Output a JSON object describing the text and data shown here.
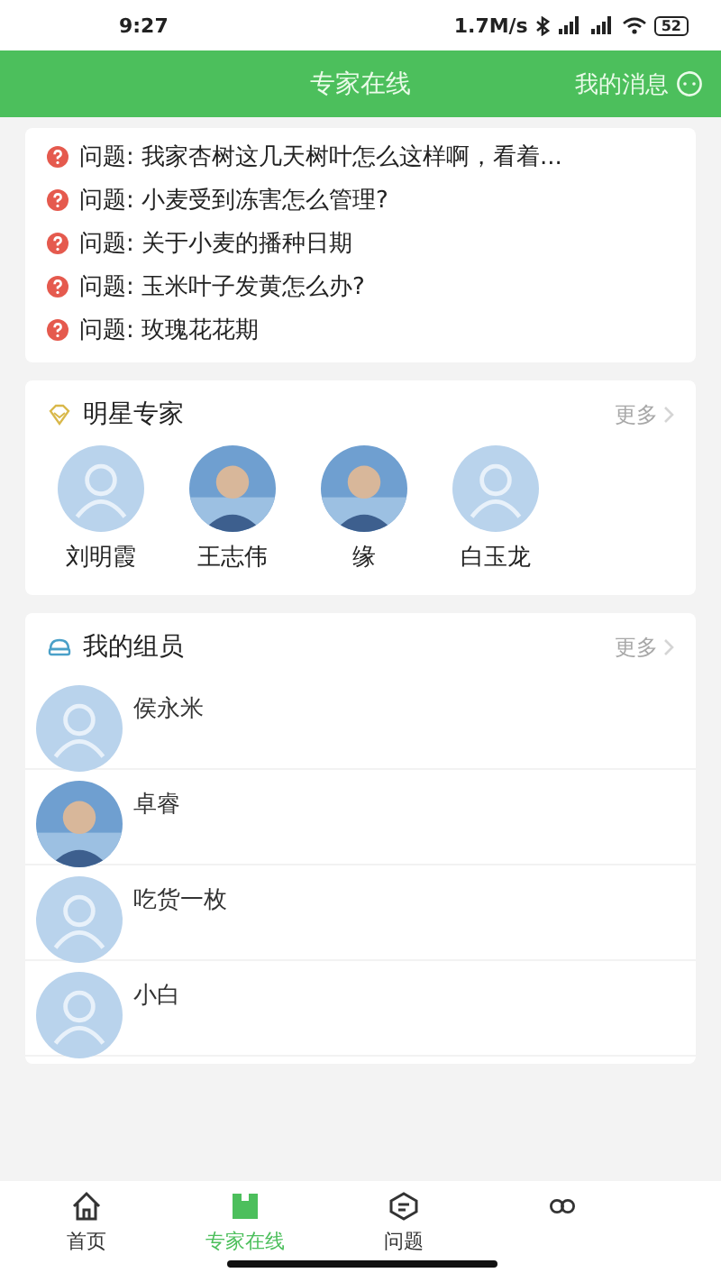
{
  "status_bar": {
    "time": "9:27",
    "speed": "1.7M/s",
    "battery": "52"
  },
  "header": {
    "title": "专家在线",
    "messages": "我的消息"
  },
  "questions": [
    {
      "prefix": "问题:",
      "text": "我家杏树这几天树叶怎么这样啊，看着..."
    },
    {
      "prefix": "问题:",
      "text": "小麦受到冻害怎么管理?"
    },
    {
      "prefix": "问题:",
      "text": "关于小麦的播种日期"
    },
    {
      "prefix": "问题:",
      "text": "玉米叶子发黄怎么办?"
    },
    {
      "prefix": "问题:",
      "text": "玫瑰花花期"
    }
  ],
  "star_experts": {
    "title": "明星专家",
    "more": "更多",
    "experts": [
      {
        "name": "刘明霞",
        "kind": "placeholder"
      },
      {
        "name": "王志伟",
        "kind": "photo"
      },
      {
        "name": "缘",
        "kind": "photo"
      },
      {
        "name": "白玉龙",
        "kind": "placeholder"
      }
    ]
  },
  "members": {
    "title": "我的组员",
    "more": "更多",
    "items": [
      {
        "name": "侯永米",
        "kind": "placeholder"
      },
      {
        "name": "卓睿",
        "kind": "photo"
      },
      {
        "name": "吃货一枚",
        "kind": "placeholder"
      },
      {
        "name": "小白",
        "kind": "placeholder"
      }
    ]
  },
  "tab_bar": [
    {
      "label": "首页",
      "selected": false
    },
    {
      "label": "专家在线",
      "selected": true
    },
    {
      "label": "问题",
      "selected": false
    },
    {
      "selected": false
    }
  ]
}
